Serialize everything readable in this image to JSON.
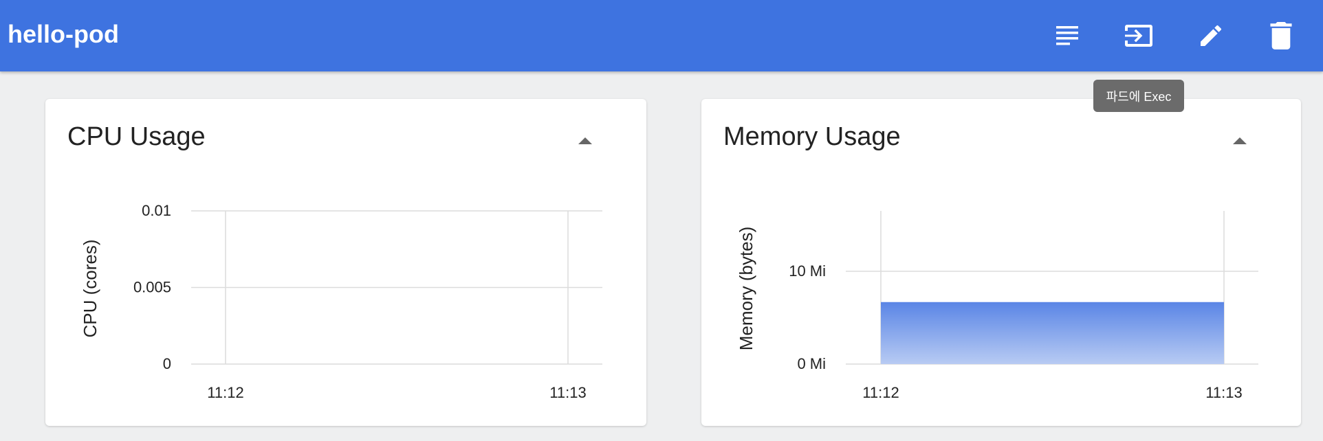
{
  "header": {
    "title": "hello-pod",
    "actions": [
      {
        "name": "logs-icon",
        "label": "Logs"
      },
      {
        "name": "exec-icon",
        "label": "Exec"
      },
      {
        "name": "edit-icon",
        "label": "Edit"
      },
      {
        "name": "delete-icon",
        "label": "Delete"
      }
    ],
    "tooltip": "파드에 Exec"
  },
  "colors": {
    "toolbar": "#3e73e0",
    "fill_top": "#5b86e6",
    "fill_bottom": "#b8cbf3"
  },
  "cards": {
    "cpu": {
      "title": "CPU Usage"
    },
    "memory": {
      "title": "Memory Usage"
    }
  },
  "chart_data": [
    {
      "type": "area",
      "title": "CPU Usage",
      "ylabel": "CPU (cores)",
      "xlabel": "",
      "x_ticks": [
        "11:12",
        "11:13"
      ],
      "y_ticks": [
        "0",
        "0.005",
        "0.01"
      ],
      "y_tick_values": [
        0,
        0.005,
        0.01
      ],
      "ylim": [
        0,
        0.01
      ],
      "series": [
        {
          "x": [
            "11:12",
            "11:13"
          ],
          "values": [
            0,
            0
          ]
        }
      ],
      "grid": true
    },
    {
      "type": "area",
      "title": "Memory Usage",
      "ylabel": "Memory (bytes)",
      "xlabel": "",
      "x_ticks": [
        "11:12",
        "11:13"
      ],
      "y_ticks": [
        "0 Mi",
        "10 Mi"
      ],
      "y_tick_values": [
        0,
        10
      ],
      "ylim": [
        0,
        16.5
      ],
      "series": [
        {
          "x": [
            "11:12",
            "11:13"
          ],
          "values": [
            6.6,
            6.6
          ]
        }
      ],
      "grid": true
    }
  ]
}
